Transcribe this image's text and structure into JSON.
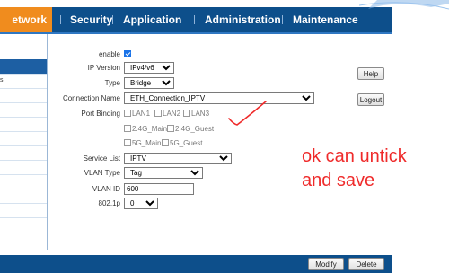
{
  "nav": {
    "active": "etwork",
    "items": [
      "Security",
      "Application",
      "Administration",
      "Maintenance"
    ],
    "separator": "|"
  },
  "sidebar": {
    "item_s": "s"
  },
  "form": {
    "enable_label": "enable",
    "enable_checked": true,
    "ip_version_label": "IP Version",
    "ip_version_value": "IPv4/v6",
    "type_label": "Type",
    "type_value": "Bridge",
    "connection_name_label": "Connection Name",
    "connection_name_value": "ETH_Connection_IPTV",
    "port_binding_label": "Port Binding",
    "ports": [
      "LAN1",
      "LAN2",
      "LAN3",
      "2.4G_Main",
      "2.4G_Guest",
      "5G_Main",
      "5G_Guest"
    ],
    "service_list_label": "Service List",
    "service_list_value": "IPTV",
    "vlan_type_label": "VLAN Type",
    "vlan_type_value": "Tag",
    "vlan_id_label": "VLAN ID",
    "vlan_id_value": "600",
    "priority_label": "802.1p",
    "priority_value": "0"
  },
  "side_buttons": {
    "help": "Help",
    "logout": "Logout"
  },
  "bottom_buttons": {
    "modify": "Modify",
    "delete": "Delete"
  },
  "annotation": {
    "line1": "ok can untick",
    "line2": "and save",
    "color": "#ef2b2b"
  },
  "colors": {
    "nav": "#0d4f8b",
    "nav_active": "#f08c1e",
    "checkbox": "#1a73e8"
  }
}
